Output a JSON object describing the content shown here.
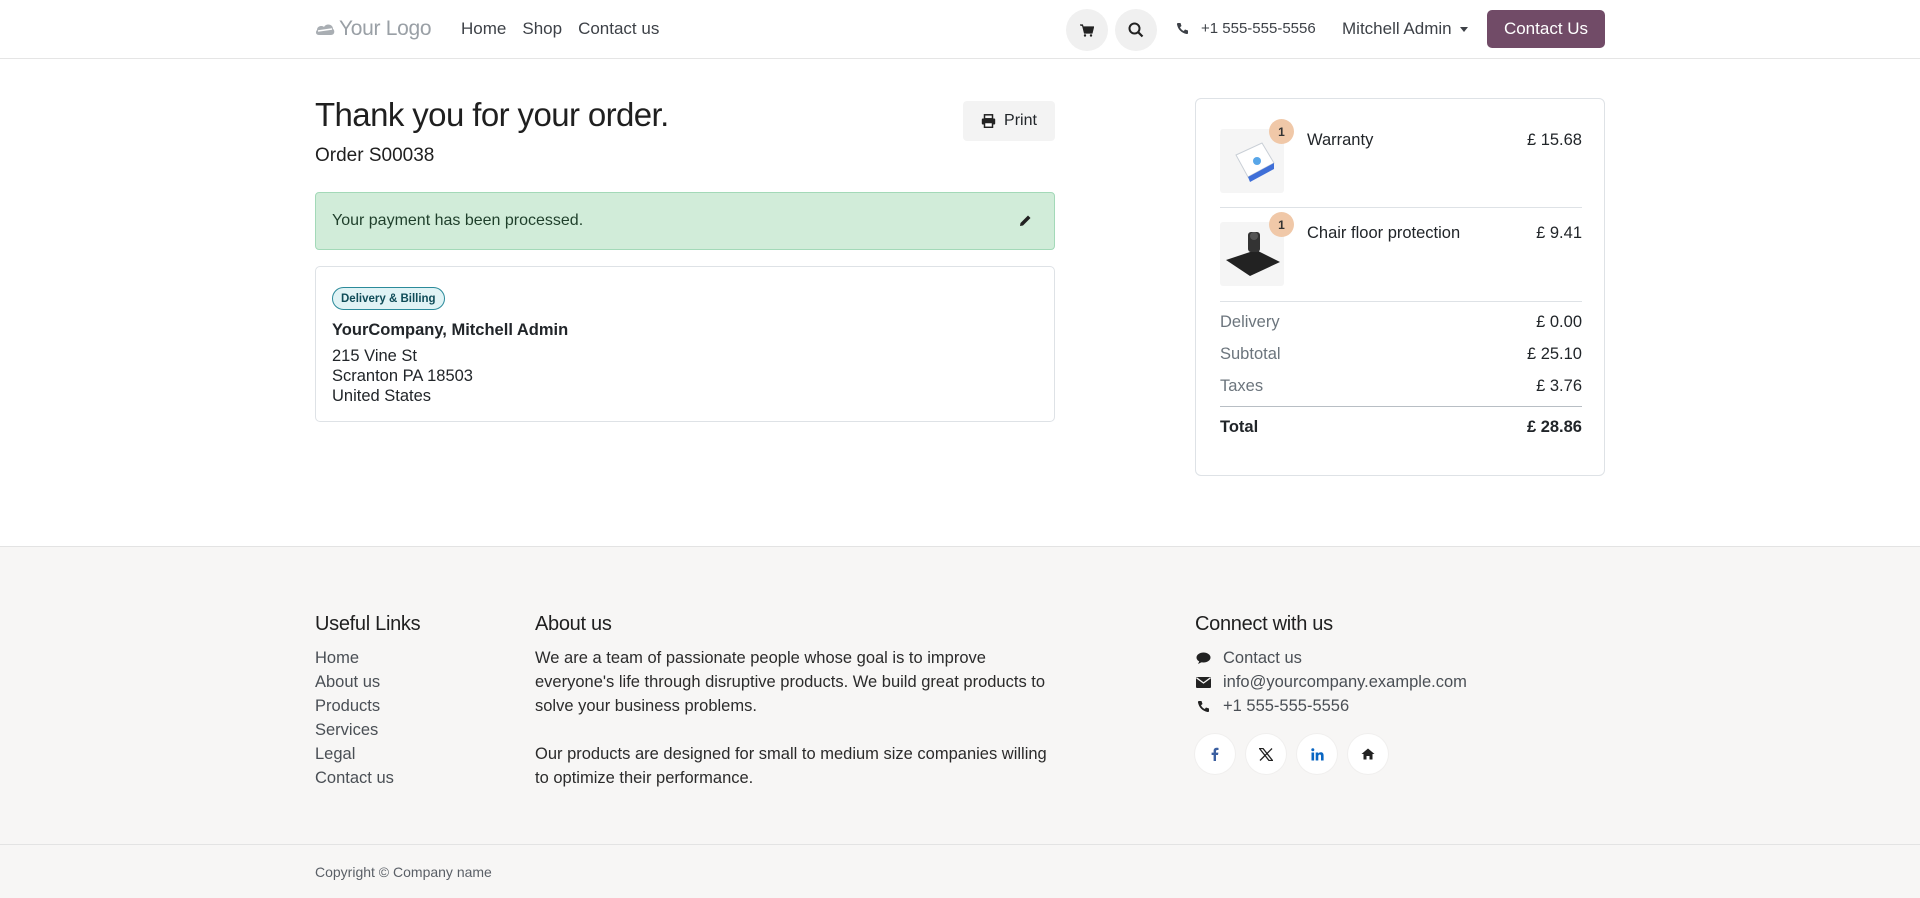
{
  "header": {
    "logo_text": "Your Logo",
    "nav": [
      "Home",
      "Shop",
      "Contact us"
    ],
    "phone": "+1 555-555-5556",
    "user": "Mitchell Admin",
    "cta": "Contact Us"
  },
  "confirmation": {
    "title": "Thank you for your order.",
    "order_ref": "Order S00038",
    "print_label": "Print",
    "payment_status": "Your payment has been processed."
  },
  "address": {
    "badge": "Delivery & Billing",
    "name": "YourCompany, Mitchell Admin",
    "lines": [
      "215 Vine St",
      "Scranton PA 18503",
      "United States"
    ]
  },
  "summary": {
    "items": [
      {
        "qty": "1",
        "name": "Warranty",
        "price": "£ 15.68"
      },
      {
        "qty": "1",
        "name": "Chair floor protection",
        "price": "£ 9.41"
      }
    ],
    "rows": [
      {
        "label": "Delivery",
        "value": "£ 0.00"
      },
      {
        "label": "Subtotal",
        "value": "£ 25.10"
      },
      {
        "label": "Taxes",
        "value": "£ 3.76"
      }
    ],
    "total": {
      "label": "Total",
      "value": "£ 28.86"
    }
  },
  "footer": {
    "useful_links_title": "Useful Links",
    "useful_links": [
      "Home",
      "About us",
      "Products",
      "Services",
      "Legal",
      "Contact us"
    ],
    "about_title": "About us",
    "about_p1": "We are a team of passionate people whose goal is to improve everyone's life through disruptive products. We build great products to solve your business problems.",
    "about_p2": "Our products are designed for small to medium size companies willing to optimize their performance.",
    "connect_title": "Connect with us",
    "contact_items": [
      {
        "icon": "comment-icon",
        "text": "Contact us"
      },
      {
        "icon": "envelope-icon",
        "text": "info@yourcompany.example.com"
      },
      {
        "icon": "phone-icon",
        "text": "+1 555-555-5556"
      }
    ],
    "socials": [
      "facebook-icon",
      "x-icon",
      "linkedin-icon",
      "home-icon"
    ],
    "copyright": "Copyright © Company name"
  },
  "colors": {
    "brand": "#714b67",
    "success_bg": "#d1ecd9",
    "badge_border": "#2b8a9a",
    "qty_badge": "#f0c8a8",
    "footer_bg": "#f7f6f5"
  }
}
